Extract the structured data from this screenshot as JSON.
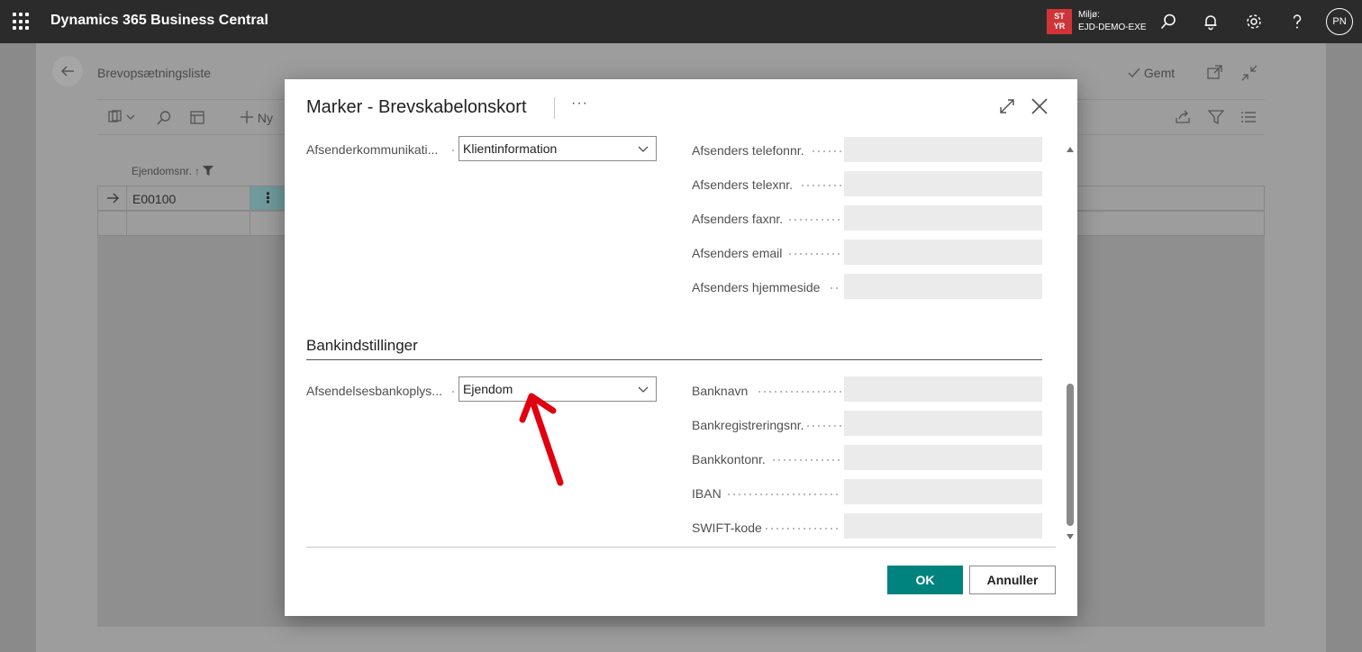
{
  "topbar": {
    "app_title": "Dynamics 365 Business Central",
    "env_badge_line1": "ST",
    "env_badge_line2": "YR",
    "env_label": "Miljø:",
    "env_name": "EJD-DEMO-EXE",
    "avatar_initials": "PN",
    "env_badge_color": "#d13438"
  },
  "background_page": {
    "title": "Brevopsætningsliste",
    "saved_label": "Gemt",
    "new_label": "Ny",
    "column_header": "Ejendomsnr.",
    "sort_indicator": "↑",
    "rows": [
      {
        "value": "E00100"
      },
      {
        "value": ""
      }
    ]
  },
  "dialog": {
    "title": "Marker - Brevskabelonskort",
    "more": "···",
    "left_fields": [
      {
        "label": "Afsenderkommunikati...",
        "value": "Klientinformation"
      }
    ],
    "right_fields": [
      {
        "label": "Afsenders telefonnr.",
        "value": ""
      },
      {
        "label": "Afsenders telexnr.",
        "value": ""
      },
      {
        "label": "Afsenders faxnr.",
        "value": ""
      },
      {
        "label": "Afsenders email",
        "value": ""
      },
      {
        "label": "Afsenders hjemmeside",
        "value": ""
      }
    ],
    "bank_section": {
      "title": "Bankindstillinger",
      "left_field": {
        "label": "Afsendelsesbankoplys...",
        "value": "Ejendom"
      },
      "right_fields": [
        {
          "label": "Banknavn",
          "value": ""
        },
        {
          "label": "Bankregistreringsnr.",
          "value": ""
        },
        {
          "label": "Bankkontonr.",
          "value": ""
        },
        {
          "label": "IBAN",
          "value": ""
        },
        {
          "label": "SWIFT-kode",
          "value": ""
        }
      ]
    },
    "ok_label": "OK",
    "cancel_label": "Annuller",
    "accent_color": "#00827f",
    "annotation_arrow_color": "#e0000f"
  }
}
